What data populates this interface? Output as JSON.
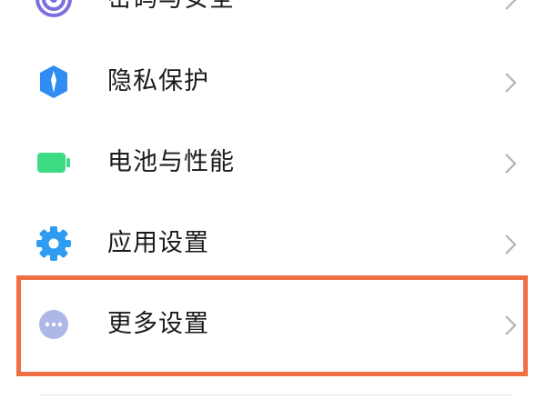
{
  "settings": {
    "items": [
      {
        "label": "密码与安全",
        "icon": "fingerprint-icon"
      },
      {
        "label": "隐私保护",
        "icon": "privacy-shield-icon"
      },
      {
        "label": "电池与性能",
        "icon": "battery-icon"
      },
      {
        "label": "应用设置",
        "icon": "gear-icon"
      },
      {
        "label": "更多设置",
        "icon": "more-dots-icon"
      }
    ]
  },
  "colors": {
    "password_icon": "#7b6fe0",
    "privacy_icon": "#2f8cf0",
    "battery_icon": "#3ddc84",
    "apps_icon": "#2e9cf0",
    "more_icon": "#aeb8e8",
    "highlight": "#ef6f45",
    "chevron": "#b3b3b3"
  }
}
